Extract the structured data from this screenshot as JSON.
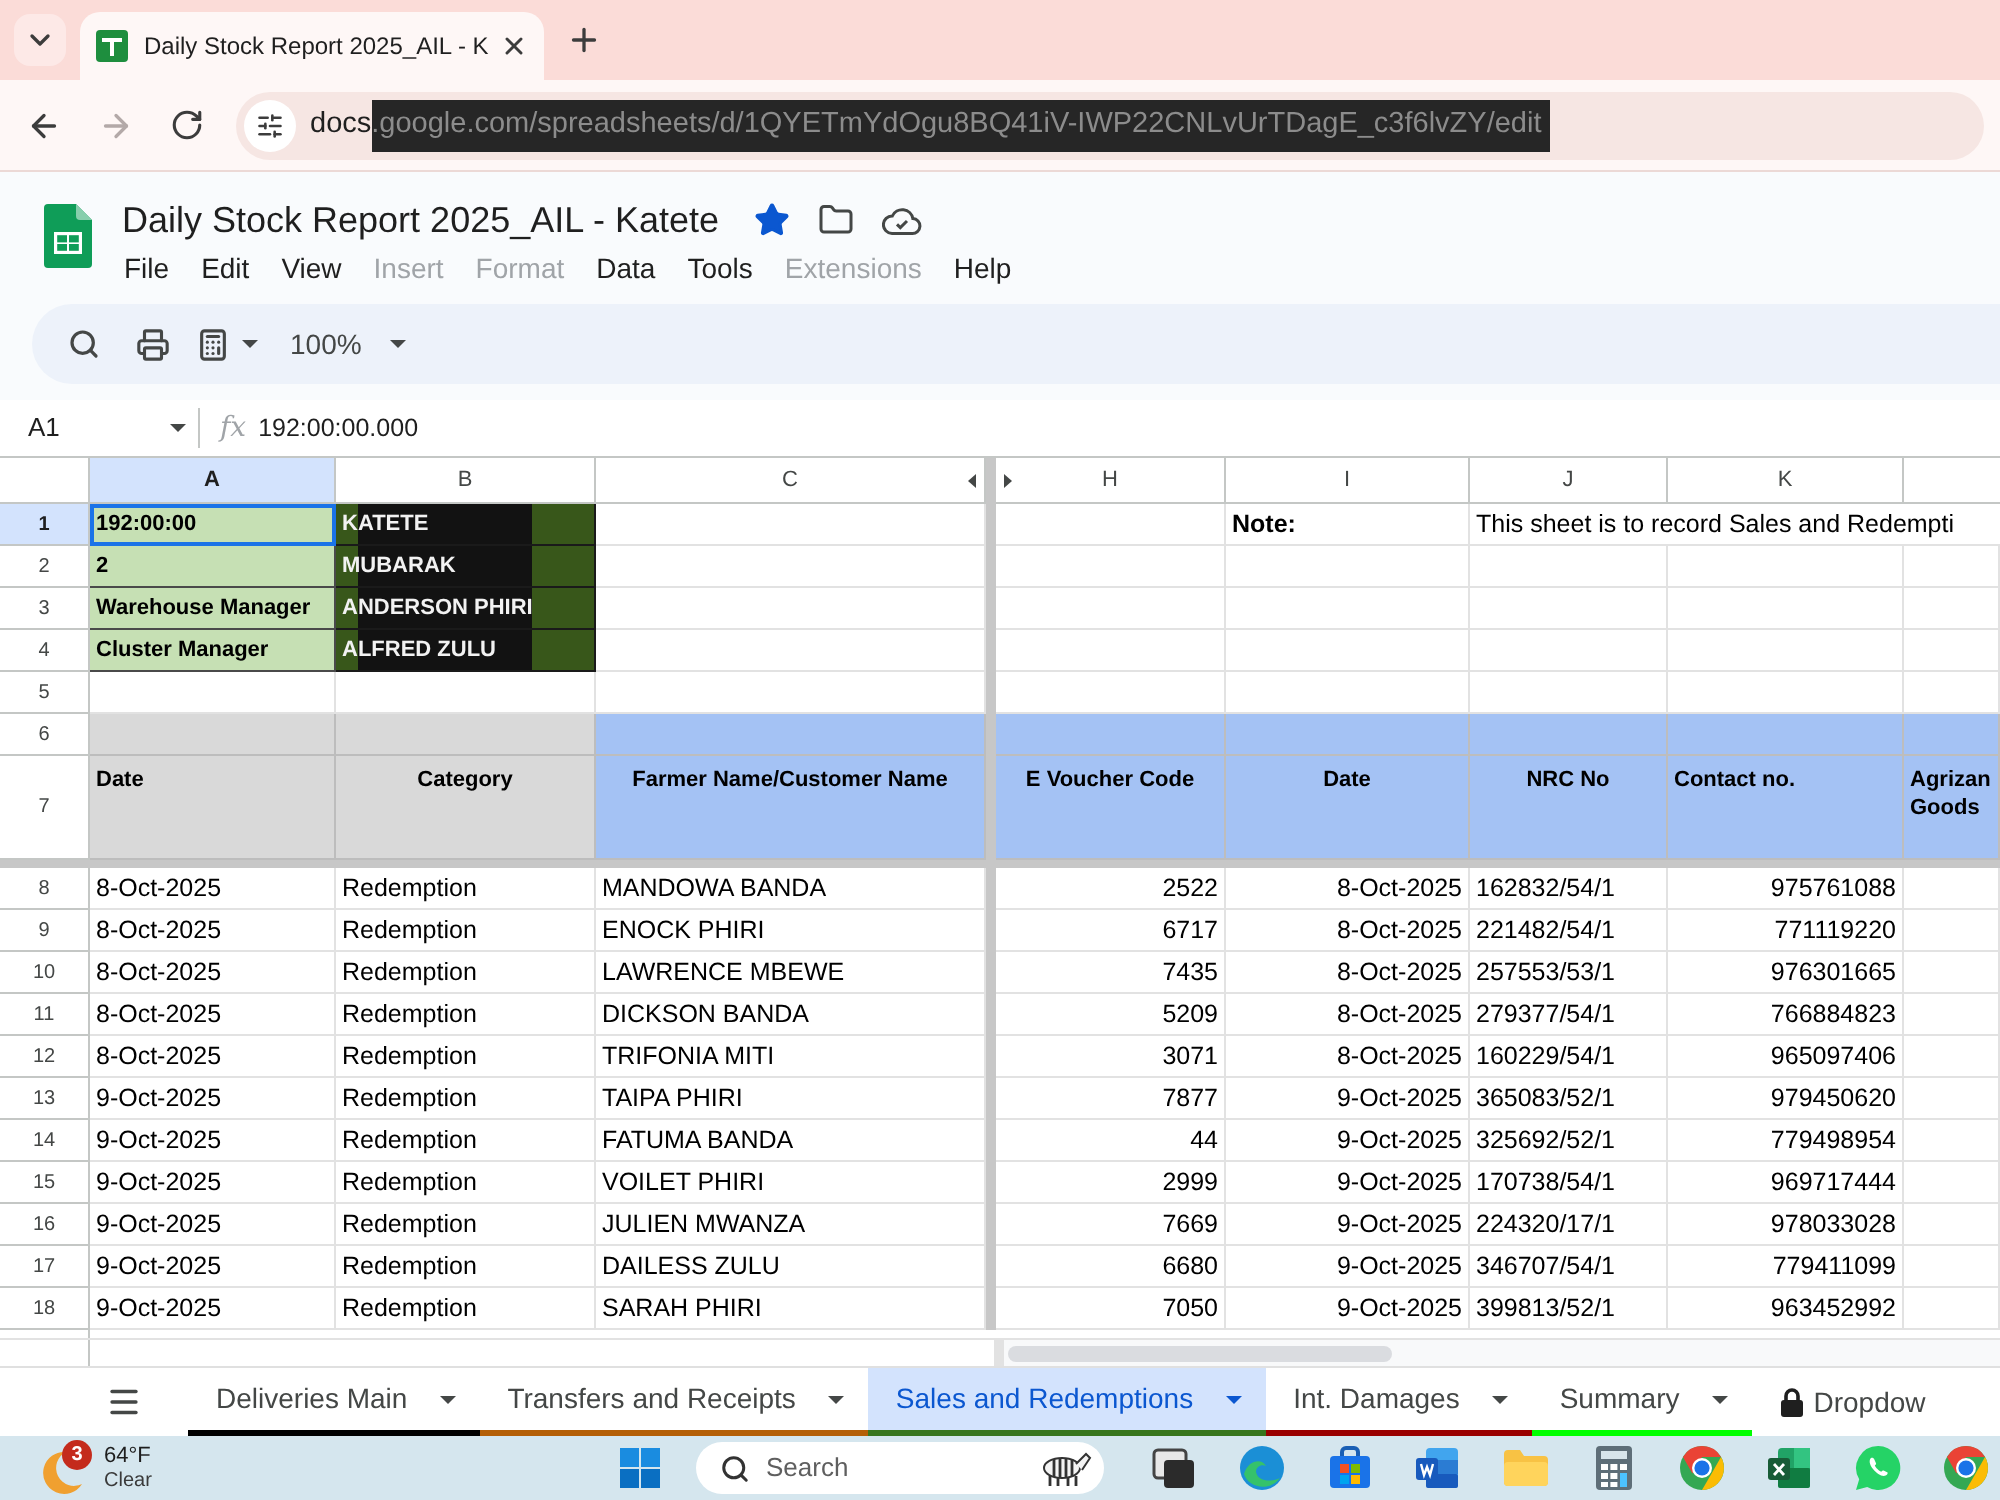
{
  "browser": {
    "tabs": [
      {
        "title": "Daily Stock Report 2025_AIL - K",
        "selected": true
      }
    ],
    "url": "docs.google.com/spreadsheets/d/1QYETmYdOgu8BQ41iV-IWP22CNLvUrTDagE_c3f6lvZY/edit"
  },
  "document": {
    "title": "Daily Stock Report 2025_AIL - Katete",
    "starred": true
  },
  "menu": [
    {
      "label": "File",
      "disabled": false
    },
    {
      "label": "Edit",
      "disabled": false
    },
    {
      "label": "View",
      "disabled": false
    },
    {
      "label": "Insert",
      "disabled": true
    },
    {
      "label": "Format",
      "disabled": true
    },
    {
      "label": "Data",
      "disabled": false
    },
    {
      "label": "Tools",
      "disabled": false
    },
    {
      "label": "Extensions",
      "disabled": true
    },
    {
      "label": "Help",
      "disabled": false
    }
  ],
  "toolbar": {
    "zoom": "100%"
  },
  "formula_bar": {
    "cell_ref": "A1",
    "fx_symbol": "fx",
    "formula": "192:00:00.000"
  },
  "sheet": {
    "columns": [
      {
        "label": "A",
        "selected": true
      },
      {
        "label": "B",
        "selected": false
      },
      {
        "label": "C",
        "selected": false
      },
      {
        "label": "H",
        "selected": false
      },
      {
        "label": "I",
        "selected": false
      },
      {
        "label": "J",
        "selected": false
      },
      {
        "label": "K",
        "selected": false
      }
    ],
    "rows": [
      {
        "number": "1",
        "selected": true,
        "kind": "info",
        "cells": [
          "192:00:00",
          "KATETE",
          null,
          null,
          "Note:",
          "This sheet is to record Sales and Redempti"
        ]
      },
      {
        "number": "2",
        "selected": false,
        "kind": "info",
        "cells": [
          "2",
          "MUBARAK"
        ]
      },
      {
        "number": "3",
        "selected": false,
        "kind": "info",
        "cells": [
          "Warehouse Manager",
          "ANDERSON PHIRI"
        ]
      },
      {
        "number": "4",
        "selected": false,
        "kind": "info",
        "cells": [
          "Cluster Manager",
          "ALFRED ZULU"
        ]
      },
      {
        "number": "5",
        "selected": false,
        "kind": "blank"
      },
      {
        "number": "6",
        "selected": false,
        "kind": "band"
      },
      {
        "number": "7",
        "selected": false,
        "kind": "header",
        "cells": [
          "Date",
          "Category",
          "Farmer Name/Customer Name",
          "E Voucher Code",
          "Date",
          "NRC No",
          "Contact no.",
          "Agrizan Goods"
        ]
      },
      {
        "number": "8",
        "selected": false,
        "kind": "data",
        "cells": [
          "8-Oct-2025",
          "Redemption",
          "MANDOWA BANDA",
          "2522",
          "8-Oct-2025",
          "162832/54/1",
          "975761088"
        ]
      },
      {
        "number": "9",
        "selected": false,
        "kind": "data",
        "cells": [
          "8-Oct-2025",
          "Redemption",
          "ENOCK PHIRI",
          "6717",
          "8-Oct-2025",
          "221482/54/1",
          "771119220"
        ]
      },
      {
        "number": "10",
        "selected": false,
        "kind": "data",
        "cells": [
          "8-Oct-2025",
          "Redemption",
          "LAWRENCE MBEWE",
          "7435",
          "8-Oct-2025",
          "257553/53/1",
          "976301665"
        ]
      },
      {
        "number": "11",
        "selected": false,
        "kind": "data",
        "cells": [
          "8-Oct-2025",
          "Redemption",
          "DICKSON BANDA",
          "5209",
          "8-Oct-2025",
          "279377/54/1",
          "766884823"
        ]
      },
      {
        "number": "12",
        "selected": false,
        "kind": "data",
        "cells": [
          "8-Oct-2025",
          "Redemption",
          "TRIFONIA MITI",
          "3071",
          "8-Oct-2025",
          "160229/54/1",
          "965097406"
        ]
      },
      {
        "number": "13",
        "selected": false,
        "kind": "data",
        "cells": [
          "9-Oct-2025",
          "Redemption",
          "TAIPA PHIRI",
          "7877",
          "9-Oct-2025",
          "365083/52/1",
          "979450620"
        ]
      },
      {
        "number": "14",
        "selected": false,
        "kind": "data",
        "cells": [
          "9-Oct-2025",
          "Redemption",
          "FATUMA BANDA",
          "44",
          "9-Oct-2025",
          "325692/52/1",
          "779498954"
        ]
      },
      {
        "number": "15",
        "selected": false,
        "kind": "data",
        "cells": [
          "9-Oct-2025",
          "Redemption",
          "VOILET PHIRI",
          "2999",
          "9-Oct-2025",
          "170738/54/1",
          "969717444"
        ]
      },
      {
        "number": "16",
        "selected": false,
        "kind": "data",
        "cells": [
          "9-Oct-2025",
          "Redemption",
          "JULIEN MWANZA",
          "7669",
          "9-Oct-2025",
          "224320/17/1",
          "978033028"
        ]
      },
      {
        "number": "17",
        "selected": false,
        "kind": "data",
        "cells": [
          "9-Oct-2025",
          "Redemption",
          "DAILESS ZULU",
          "6680",
          "9-Oct-2025",
          "346707/54/1",
          "779411099"
        ]
      },
      {
        "number": "18",
        "selected": false,
        "kind": "data",
        "cells": [
          "9-Oct-2025",
          "Redemption",
          "SARAH PHIRI",
          "7050",
          "9-Oct-2025",
          "399813/52/1",
          "963452992"
        ]
      }
    ]
  },
  "sheet_tabs": [
    {
      "label": "Deliveries Main",
      "color": "#000000",
      "selected": false,
      "locked": false
    },
    {
      "label": "Transfers and Receipts",
      "color": "#b45f06",
      "selected": false,
      "locked": false
    },
    {
      "label": "Sales and Redemptions",
      "color": "#38761d",
      "selected": true,
      "locked": false
    },
    {
      "label": "Int. Damages",
      "color": "#990000",
      "selected": false,
      "locked": false
    },
    {
      "label": "Summary",
      "color": "#00ff00",
      "selected": false,
      "locked": false
    },
    {
      "label": "Dropdow",
      "selected": false,
      "locked": true
    }
  ],
  "taskbar": {
    "weather": {
      "badge": "3",
      "temperature": "64°F",
      "condition": "Clear"
    },
    "search": {
      "placeholder": "Search"
    }
  }
}
